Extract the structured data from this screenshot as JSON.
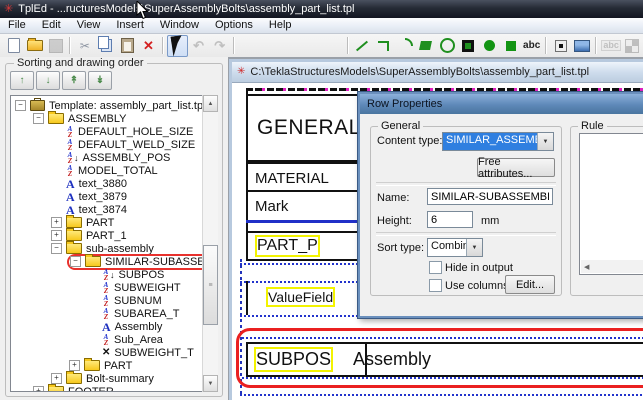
{
  "window": {
    "title": "TplEd - ...ructuresModels\\SuperAssemblyBolts\\assembly_part_list.tpl"
  },
  "menu": {
    "items": [
      "File",
      "Edit",
      "View",
      "Insert",
      "Window",
      "Options",
      "Help"
    ]
  },
  "toolbar": {
    "items": [
      {
        "icon": "new-file"
      },
      {
        "icon": "open-folder"
      },
      {
        "icon": "save",
        "state": "disabled"
      },
      {
        "sep": true
      },
      {
        "icon": "cut",
        "glyph": "✂"
      },
      {
        "icon": "copy"
      },
      {
        "icon": "paste"
      },
      {
        "icon": "delete",
        "glyph": "✕"
      },
      {
        "sep": true
      },
      {
        "icon": "select-arrow",
        "state": "pressed"
      },
      {
        "icon": "undo",
        "glyph": "↶",
        "state": "disabled"
      },
      {
        "icon": "redo",
        "glyph": "↷",
        "state": "disabled"
      },
      {
        "sep": true
      },
      {
        "icon": "align-1"
      },
      {
        "icon": "align-2"
      },
      {
        "icon": "align-3"
      },
      {
        "icon": "align-4"
      },
      {
        "icon": "align-5"
      },
      {
        "sep": true
      },
      {
        "icon": "line"
      },
      {
        "icon": "polyline"
      },
      {
        "icon": "arc"
      },
      {
        "icon": "polygon"
      },
      {
        "icon": "circle"
      },
      {
        "icon": "rectangle"
      },
      {
        "icon": "filled-circle"
      },
      {
        "icon": "filled-rect"
      },
      {
        "icon": "text-tool",
        "glyph": "abc"
      },
      {
        "sep": true
      },
      {
        "icon": "valuefield-tool"
      },
      {
        "icon": "picture-tool"
      },
      {
        "sep": true
      },
      {
        "icon": "field-text-tool",
        "glyph": "abc",
        "state": "disabled"
      },
      {
        "icon": "template-check",
        "state": "disabled"
      }
    ]
  },
  "sidebar": {
    "title": "Sorting and drawing order",
    "buttons": [
      {
        "name": "move-up",
        "glyph": "↑"
      },
      {
        "name": "move-down",
        "glyph": "↓"
      },
      {
        "name": "move-to-top",
        "glyph": "↟"
      },
      {
        "name": "move-to-bottom",
        "glyph": "↡"
      }
    ],
    "tree": [
      {
        "label": "Template: assembly_part_list.tpl",
        "level": 0,
        "icon": "template-icon",
        "expander": "minus"
      },
      {
        "label": "ASSEMBLY",
        "level": 1,
        "icon": "folder-icon",
        "expander": "minus"
      },
      {
        "label": "DEFAULT_HOLE_SIZE",
        "level": 2,
        "icon": "sort-icon"
      },
      {
        "label": "DEFAULT_WELD_SIZE",
        "level": 2,
        "icon": "sort-icon"
      },
      {
        "label": "ASSEMBLY_POS",
        "level": 2,
        "icon": "sort-arrow-icon"
      },
      {
        "label": "MODEL_TOTAL",
        "level": 2,
        "icon": "sort-icon"
      },
      {
        "label": "text_3880",
        "level": 2,
        "icon": "text-icon"
      },
      {
        "label": "text_3879",
        "level": 2,
        "icon": "text-icon"
      },
      {
        "label": "text_3874",
        "level": 2,
        "icon": "text-icon"
      },
      {
        "label": "PART",
        "level": 2,
        "icon": "folder-icon",
        "expander": "plus"
      },
      {
        "label": "PART_1",
        "level": 2,
        "icon": "folder-icon",
        "expander": "plus"
      },
      {
        "label": "sub-assembly",
        "level": 2,
        "icon": "folder-icon",
        "expander": "minus"
      },
      {
        "label": "SIMILAR-SUBASSEMBLY",
        "level": 3,
        "icon": "folder-icon",
        "expander": "minus",
        "highlighted": true
      },
      {
        "label": "SUBPOS",
        "level": 4,
        "icon": "sort-arrow-icon"
      },
      {
        "label": "SUBWEIGHT",
        "level": 4,
        "icon": "sort-icon"
      },
      {
        "label": "SUBNUM",
        "level": 4,
        "icon": "sort-icon"
      },
      {
        "label": "SUBAREA_T",
        "level": 4,
        "icon": "sort-icon"
      },
      {
        "label": "Assembly",
        "level": 4,
        "icon": "text-icon"
      },
      {
        "label": "Sub_Area",
        "level": 4,
        "icon": "sort-icon"
      },
      {
        "label": "SUBWEIGHT_T",
        "level": 4,
        "icon": "cross-icon"
      },
      {
        "label": "PART",
        "level": 3,
        "icon": "folder-icon",
        "expander": "plus"
      },
      {
        "label": "Bolt-summary",
        "level": 2,
        "icon": "folder-icon",
        "expander": "plus"
      },
      {
        "label": "FOOTER",
        "level": 1,
        "icon": "folder-icon",
        "expander": "plus"
      }
    ]
  },
  "document": {
    "title": "C:\\TeklaStructuresModels\\SuperAssemblyBolts\\assembly_part_list.tpl",
    "rows": {
      "general": "GENERAL",
      "material": "MATERIAL",
      "mark": "Mark",
      "part": "PART_P",
      "valuefield": "ValueField",
      "subpos": "SUBPOS",
      "assembly": "Assembly"
    }
  },
  "dialog": {
    "title": "Row Properties",
    "general_label": "General",
    "content_type_label": "Content type:",
    "content_type_value": "SIMILAR_ASSEMBLY",
    "free_attributes_button": "Free attributes...",
    "name_label": "Name:",
    "name_value": "SIMILAR-SUBASSEMBLY",
    "height_label": "Height:",
    "height_value": "6",
    "height_unit": "mm",
    "sort_type_label": "Sort type:",
    "sort_type_value": "Combine",
    "hide_in_output_label": "Hide in output",
    "use_columns_label": "Use columns",
    "edit_button": "Edit...",
    "rule_label": "Rule"
  },
  "colors": {
    "selection_blue": "#2f7fe0",
    "annotation_red": "#e8312d",
    "field_yellow": "#f3f300",
    "grid_blue": "#2233cc",
    "margin_magenta": "#e020c0",
    "tool_green": "#1f8f1f"
  }
}
